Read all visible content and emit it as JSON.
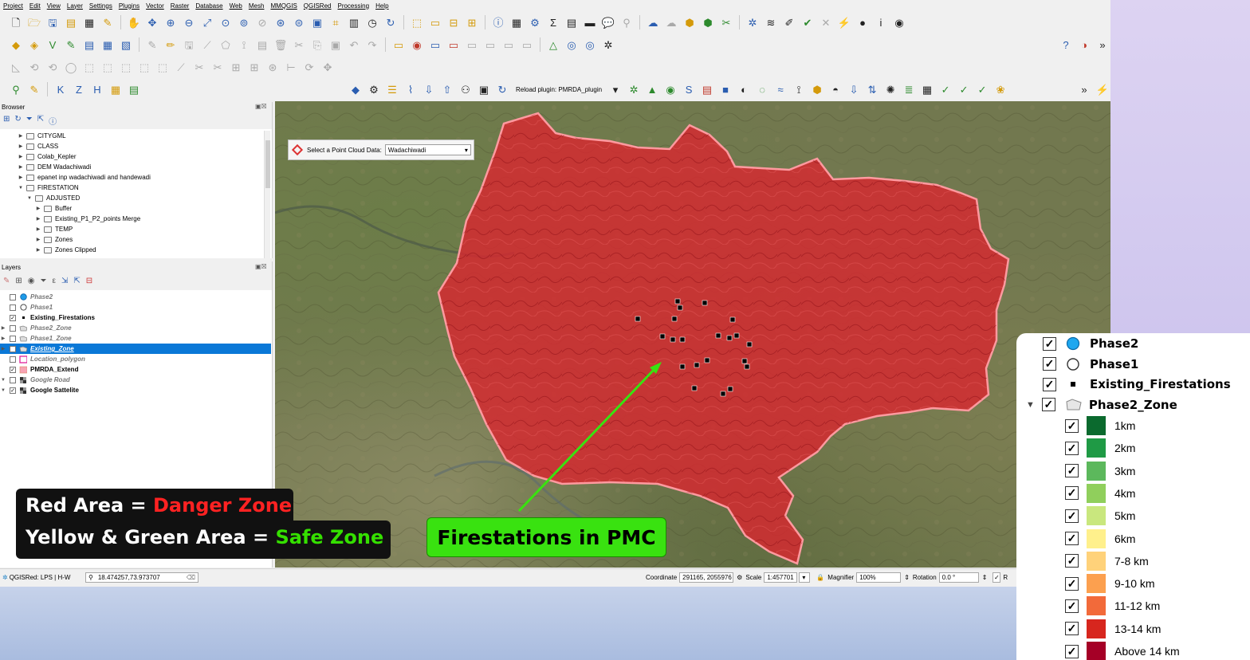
{
  "menu": [
    "Project",
    "Edit",
    "View",
    "Layer",
    "Settings",
    "Plugins",
    "Vector",
    "Raster",
    "Database",
    "Web",
    "Mesh",
    "MMQGIS",
    "QGISRed",
    "Processing",
    "Help"
  ],
  "toolbar": {
    "reload_plugin_label": "Reload plugin: PMRDA_plugin",
    "overflow": "»"
  },
  "browser": {
    "title": "Browser",
    "items": [
      {
        "label": "CITYGML",
        "level": 0,
        "expanded": false
      },
      {
        "label": "CLASS",
        "level": 0,
        "expanded": false
      },
      {
        "label": "Colab_Kepler",
        "level": 0,
        "expanded": false
      },
      {
        "label": "DEM Wadachiwadi",
        "level": 0,
        "expanded": false
      },
      {
        "label": "epanet inp wadachiwadi and handewadi",
        "level": 0,
        "expanded": false
      },
      {
        "label": "FIRESTATION",
        "level": 0,
        "expanded": true
      },
      {
        "label": "ADJUSTED",
        "level": 1,
        "expanded": true
      },
      {
        "label": "Buffer",
        "level": 2,
        "expanded": false
      },
      {
        "label": "Existing_P1_P2_points Merge",
        "level": 2,
        "expanded": false
      },
      {
        "label": "TEMP",
        "level": 2,
        "expanded": false
      },
      {
        "label": "Zones",
        "level": 2,
        "expanded": false
      },
      {
        "label": "Zones Clipped",
        "level": 2,
        "expanded": false
      }
    ]
  },
  "layers": {
    "title": "Layers",
    "items": [
      {
        "label": "Phase2",
        "checked": false,
        "symbol": "blue-circle",
        "selected": false
      },
      {
        "label": "Phase1",
        "checked": false,
        "symbol": "hollow-circle",
        "selected": false
      },
      {
        "label": "Existing_Firestations",
        "checked": true,
        "symbol": "black-square",
        "selected": false
      },
      {
        "label": "Phase2_Zone",
        "checked": false,
        "symbol": "polygon",
        "selected": false
      },
      {
        "label": "Phase1_Zone",
        "checked": false,
        "symbol": "polygon",
        "selected": false
      },
      {
        "label": "Existing_Zone",
        "checked": false,
        "symbol": "polygon",
        "selected": true
      },
      {
        "label": "Location_polygon",
        "checked": false,
        "symbol": "pink-outline",
        "selected": false
      },
      {
        "label": "PMRDA_Extend",
        "checked": true,
        "symbol": "pink-fill",
        "selected": false
      },
      {
        "label": "Google Road",
        "checked": false,
        "symbol": "raster",
        "selected": false
      },
      {
        "label": "Google Sattelite",
        "checked": true,
        "symbol": "raster",
        "selected": false
      }
    ]
  },
  "pointcloud": {
    "label": "Select a Point Cloud Data:",
    "value": "Wadachiwadi"
  },
  "statusbar": {
    "plugin": "QGISRed: LPS | H-W",
    "locator": "18.474257,73.973707",
    "coordinate_label": "Coordinate",
    "coordinate": "291165, 2055976",
    "scale_label": "Scale",
    "scale": "1:457701",
    "magnifier_label": "Magnifier",
    "magnifier": "100%",
    "rotation_label": "Rotation",
    "rotation": "0.0 °",
    "render": "R"
  },
  "annotation": {
    "line1_prefix": "Red Area = ",
    "line1_highlight": "Danger Zone",
    "line2_prefix": "Yellow & Green Area = ",
    "line2_highlight": "Safe Zone",
    "firestations": "Firestations in PMC"
  },
  "legend": {
    "layers": [
      {
        "name": "Phase2",
        "symbol": "blue-circle"
      },
      {
        "name": "Phase1",
        "symbol": "hollow-circle"
      },
      {
        "name": "Existing_Firestations",
        "symbol": "black-square"
      },
      {
        "name": "Phase2_Zone",
        "symbol": "polygon"
      }
    ],
    "classes": [
      {
        "label": "1km",
        "color": "#0b6a2e"
      },
      {
        "label": "2km",
        "color": "#1f9a45"
      },
      {
        "label": "3km",
        "color": "#5cb85c"
      },
      {
        "label": "4km",
        "color": "#90cf5c"
      },
      {
        "label": "5km",
        "color": "#c9e77e"
      },
      {
        "label": "6km",
        "color": "#fff08c"
      },
      {
        "label": "7-8 km",
        "color": "#ffd27a"
      },
      {
        "label": "9-10 km",
        "color": "#fca04f"
      },
      {
        "label": "11-12 km",
        "color": "#f26a3a"
      },
      {
        "label": "13-14 km",
        "color": "#d7261e"
      },
      {
        "label": "Above 14 km",
        "color": "#a50026"
      }
    ]
  },
  "colors": {
    "danger_zone": "#d8272f",
    "selection": "#0a78d7",
    "annotation_green": "#39e210"
  }
}
